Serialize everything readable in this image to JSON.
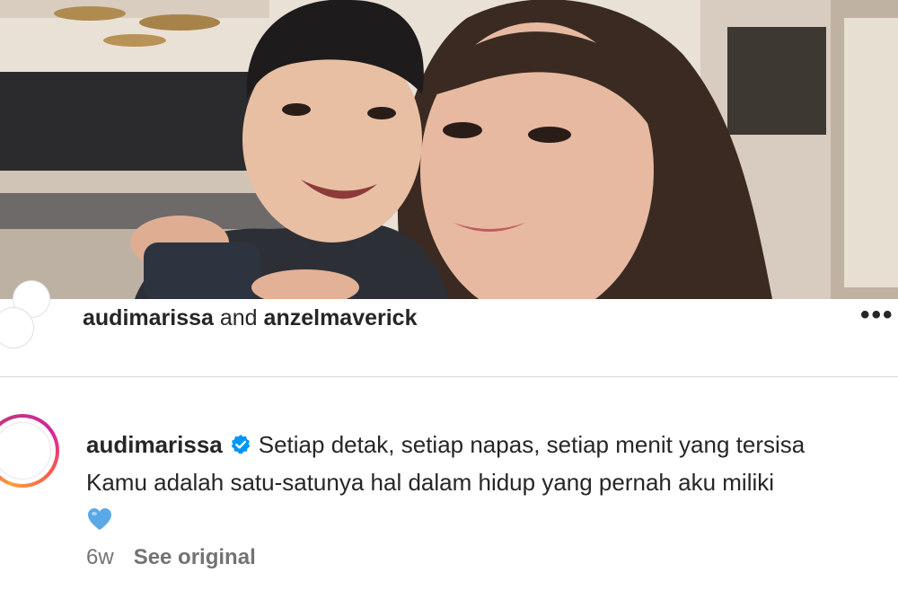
{
  "post_header": {
    "user1": "audimarissa",
    "joiner": "and",
    "user2": "anzelmaverick",
    "more_icon": "more-horizontal-icon"
  },
  "caption": {
    "username": "audimarissa",
    "verified_icon": "verified-badge-icon",
    "line1": "Setiap detak, setiap napas, setiap menit yang tersisa",
    "line2": "Kamu adalah satu-satunya hal dalam hidup yang pernah aku miliki",
    "emoji": "blue-heart-icon"
  },
  "meta": {
    "age": "6w",
    "see_original": "See original"
  },
  "colors": {
    "text": "#262626",
    "muted": "#737373",
    "verified": "#0095f6",
    "heart": "#5aa9e6",
    "divider": "#dbdbdb"
  }
}
